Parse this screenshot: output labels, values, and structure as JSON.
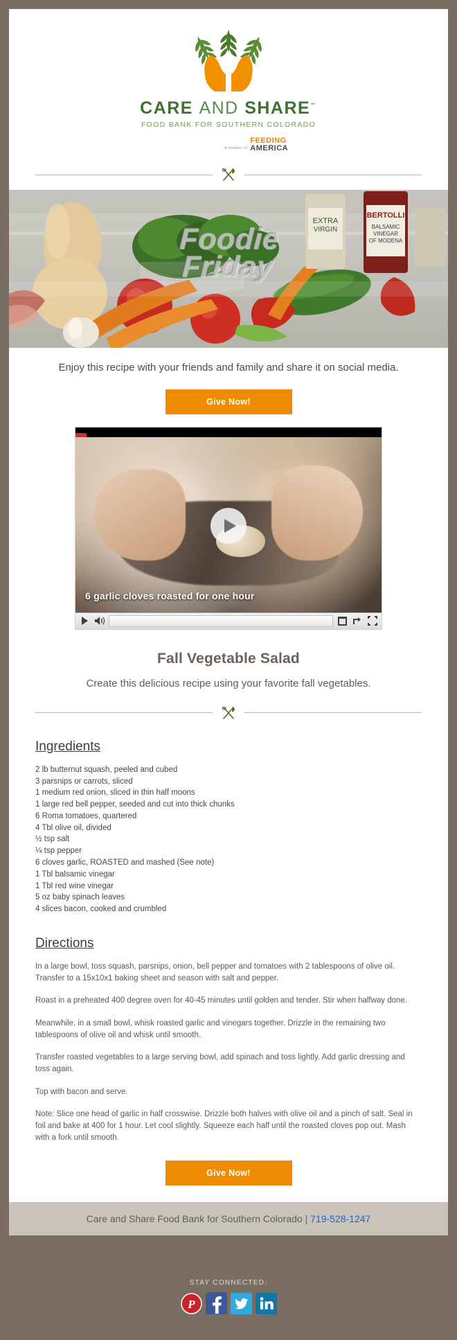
{
  "brand": {
    "name_bold": "CARE",
    "name_light": "AND",
    "name_bold2": "SHARE",
    "tm": "℠",
    "tagline": "FOOD BANK FOR SOUTHERN COLORADO",
    "member_of": "A member of",
    "partner_line1": "FEEDING",
    "partner_line2": "AMERICA"
  },
  "hero": {
    "title_line1": "Foodie",
    "title_line2": "Friday"
  },
  "intro": {
    "text": "Enjoy this recipe with your friends and family and share it on social media."
  },
  "cta": {
    "top_label": "Give Now!",
    "bottom_label": "Give Now!"
  },
  "video": {
    "caption": "6 garlic cloves roasted for one hour",
    "play_icon": "play-icon",
    "volume_icon": "volume-icon",
    "popout_icon": "popout-icon",
    "share_icon": "share-icon",
    "fullscreen_icon": "fullscreen-icon"
  },
  "recipe": {
    "title": "Fall Vegetable Salad",
    "subtitle": "Create this delicious recipe using your favorite fall vegetables.",
    "ingredients_heading": "Ingredients",
    "ingredients": [
      "2 lb butternut squash, peeled and cubed",
      "3 parsnips or carrots, sliced",
      "1 medium red onion, sliced in thin half moons",
      "1 large red bell pepper, seeded and cut into thick chunks",
      "6 Roma tomatoes, quartered",
      "4 Tbl olive oil, divided",
      "½ tsp salt",
      "¼ tsp pepper",
      "6 cloves garlic, ROASTED and mashed (See note)",
      "1 Tbl balsamic vinegar",
      "1 Tbl red wine vinegar",
      "5 oz baby spinach leaves",
      "4 slices bacon, cooked and crumbled"
    ],
    "directions_heading": "Directions",
    "directions": [
      "In a large bowl, toss squash, parsnips, onion, bell pepper and tomatoes with 2 tablespoons of olive oil. Transfer to a 15x10x1 baking sheet and season with salt and pepper.",
      "Roast in a preheated 400 degree oven for 40-45 minutes until golden and tender. Stir when halfway done.",
      "Meanwhile, in a small bowl, whisk roasted garlic and vinegars together. Drizzle in the remaining two tablespoons of olive oil and whisk until smooth.",
      "Transfer roasted vegetables to a large serving bowl, add spinach and toss lightly. Add garlic dressing and toss again.",
      "Top with bacon and serve.",
      "Note: Slice one head of garlic in half crosswise. Drizzle both halves with olive oil and a pinch of salt. Seal in foil and bake at 400 for 1 hour. Let cool slightly. Squeeze each half until the roasted cloves pop out. Mash with a fork until smooth."
    ]
  },
  "footer": {
    "org_name": "Care and Share Food Bank for Southern Colorado",
    "separator": "|",
    "phone": "719-528-1247",
    "stay_connected": "STAY CONNECTED:",
    "social": [
      {
        "name": "pinterest",
        "glyph": "P"
      },
      {
        "name": "facebook",
        "glyph": "f"
      },
      {
        "name": "twitter",
        "glyph": ""
      },
      {
        "name": "linkedin",
        "glyph": "in"
      }
    ]
  },
  "colors": {
    "brand_green": "#3f7130",
    "brand_orange": "#ef8b00",
    "page_bg": "#7a6e63",
    "footer_bar": "#c9c3ba",
    "link_blue": "#2166d6"
  }
}
